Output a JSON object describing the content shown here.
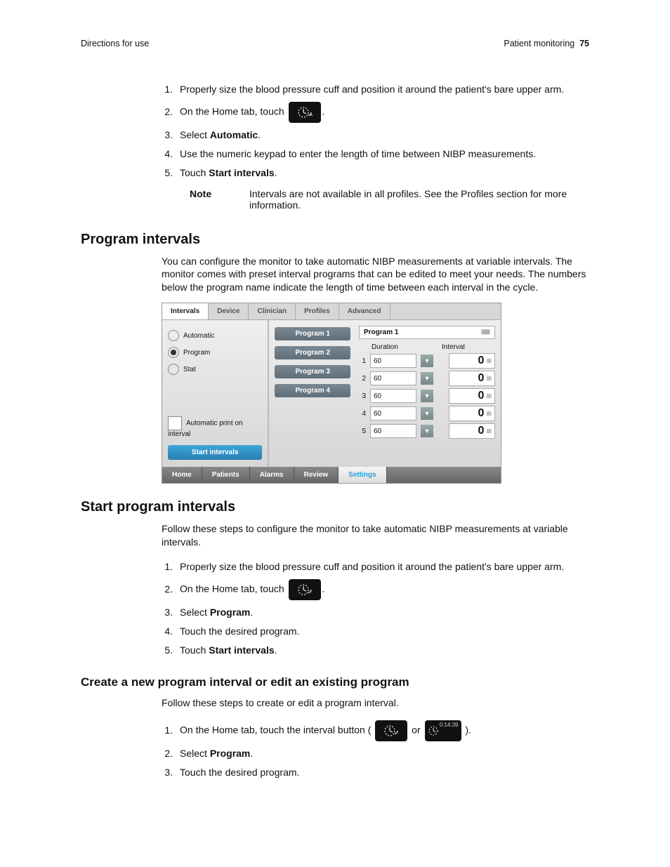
{
  "header": {
    "left": "Directions for use",
    "right_section": "Patient monitoring",
    "page": "75"
  },
  "steps1": {
    "s1": "Properly size the blood pressure cuff and position it around the patient's bare upper arm.",
    "s2a": "On the Home tab, touch ",
    "s2b": ".",
    "s3a": "Select ",
    "s3b": "Automatic",
    "s3c": ".",
    "s4": "Use the numeric keypad to enter the length of time between NIBP measurements.",
    "s5a": "Touch ",
    "s5b": "Start intervals",
    "s5c": "."
  },
  "note": {
    "label": "Note",
    "text": "Intervals are not available in all profiles. See the Profiles section for more information."
  },
  "h2a": "Program intervals",
  "p1": "You can configure the monitor to take automatic NIBP measurements at variable intervals. The monitor comes with preset interval programs that can be edited to meet your needs. The numbers below the program name indicate the length of time between each interval in the cycle.",
  "screenshot": {
    "topTabs": [
      "Intervals",
      "Device",
      "Clinician",
      "Profiles",
      "Advanced"
    ],
    "modes": [
      "Automatic",
      "Program",
      "Stat"
    ],
    "modeSelected": 1,
    "autoPrint": "Automatic print on interval",
    "startBtn": "Start intervals",
    "programs": [
      "Program 1",
      "Program 2",
      "Program 3",
      "Program 4"
    ],
    "progTitle": "Program 1",
    "durationLabel": "Duration",
    "intervalLabel": "Interval",
    "rows": [
      {
        "n": "1",
        "dur": "60",
        "ivl": "0"
      },
      {
        "n": "2",
        "dur": "60",
        "ivl": "0"
      },
      {
        "n": "3",
        "dur": "60",
        "ivl": "0"
      },
      {
        "n": "4",
        "dur": "60",
        "ivl": "0"
      },
      {
        "n": "5",
        "dur": "60",
        "ivl": "0"
      }
    ],
    "bottomTabs": [
      "Home",
      "Patients",
      "Alarms",
      "Review",
      "Settings"
    ]
  },
  "h2b": "Start program intervals",
  "p2": "Follow these steps to configure the monitor to take automatic NIBP measurements at variable intervals.",
  "steps2": {
    "s1": "Properly size the blood pressure cuff and position it around the patient's bare upper arm.",
    "s2a": "On the Home tab, touch ",
    "s3a": "Select ",
    "s3b": "Program",
    "s3c": ".",
    "s4": "Touch the desired program.",
    "s5a": "Touch ",
    "s5b": "Start intervals",
    "s5c": "."
  },
  "h3": "Create a new program interval or edit an existing program",
  "p3": "Follow these steps to create or edit a program interval.",
  "steps3": {
    "s1a": "On the Home tab, touch the interval button (",
    "s1mid": " or ",
    "s1b": ").",
    "timer": "0:14:39",
    "s2a": "Select ",
    "s2b": "Program",
    "s2c": ".",
    "s3": "Touch the desired program."
  }
}
